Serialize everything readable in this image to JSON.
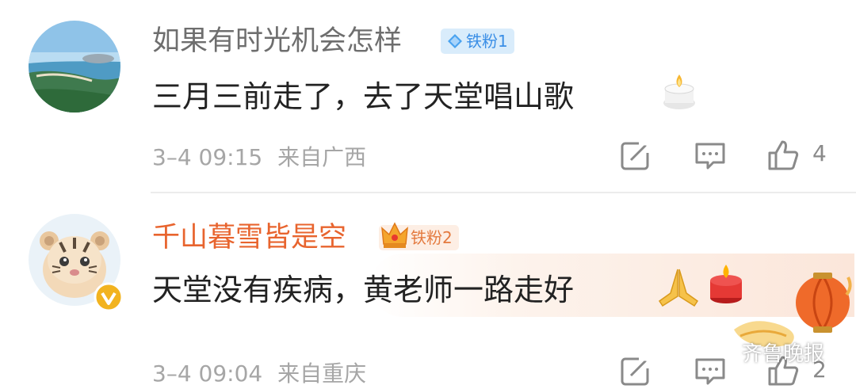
{
  "comments": [
    {
      "username": "如果有时光机会怎样",
      "badge": "铁粉1",
      "text": "三月三前走了，去了天堂唱山歌",
      "time": "3–4 09:15",
      "location": "来自广西",
      "likes": "4",
      "emoji": "candle-emoji"
    },
    {
      "username": "千山暮雪皆是空",
      "badge": "铁粉2",
      "text": "天堂没有疾病，黄老师一路走好",
      "time": "3–4 09:04",
      "location": "来自重庆",
      "likes": "2",
      "emoji": "pray-emoji"
    }
  ],
  "watermark": "齐鲁晚报",
  "colors": {
    "username_default": "#6e6e6e",
    "username_highlight": "#e8642e",
    "badge_blue": "#3a8ee6",
    "meta_gray": "#a6a6a6"
  }
}
